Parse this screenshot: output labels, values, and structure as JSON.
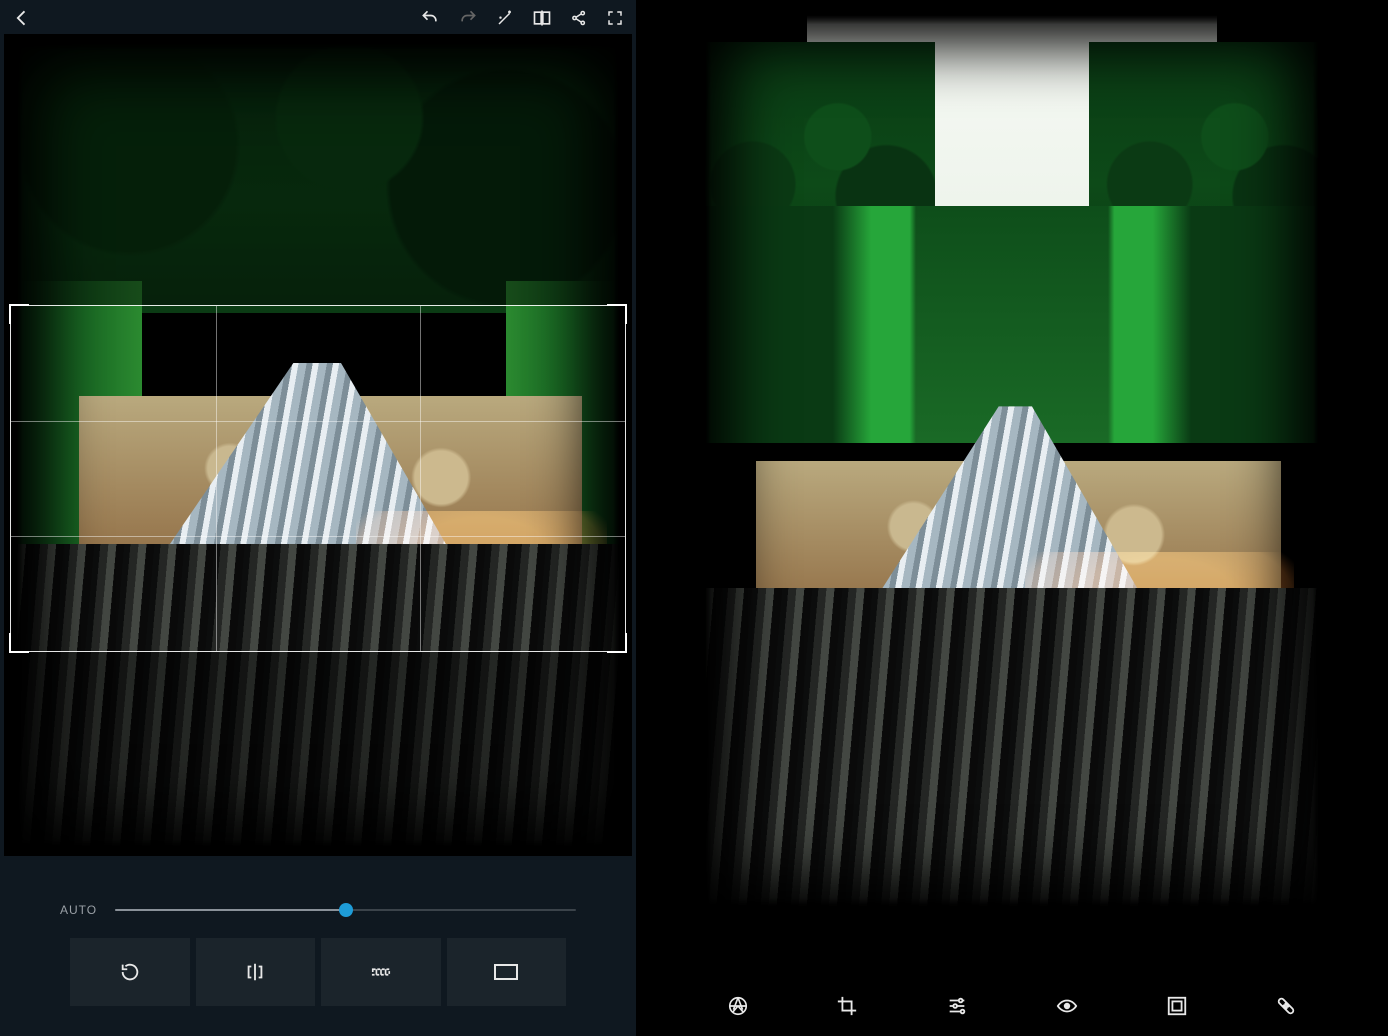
{
  "left": {
    "topbar": {
      "back_icon": "arrow-left",
      "undo_icon": "undo",
      "redo_icon": "redo",
      "wand_icon": "magic-wand",
      "compare_icon": "compare",
      "share_icon": "share",
      "fullscreen_icon": "fullscreen"
    },
    "crop": {
      "active": true,
      "grid": "rule-of-thirds"
    },
    "slider": {
      "label": "AUTO",
      "value_percent": 50
    },
    "tools": {
      "rotate_icon": "rotate",
      "flip_icon": "flip-horizontal",
      "straighten_icon": "straighten",
      "aspect_icon": "aspect-ratio"
    }
  },
  "right": {
    "tabs": {
      "lens_icon": "aperture",
      "crop_icon": "crop",
      "adjust_icon": "sliders",
      "eye_icon": "eye",
      "frame_icon": "frame",
      "heal_icon": "healing-patch"
    },
    "active_tab": "healing-patch"
  },
  "accent_color": "#1e9cd8"
}
